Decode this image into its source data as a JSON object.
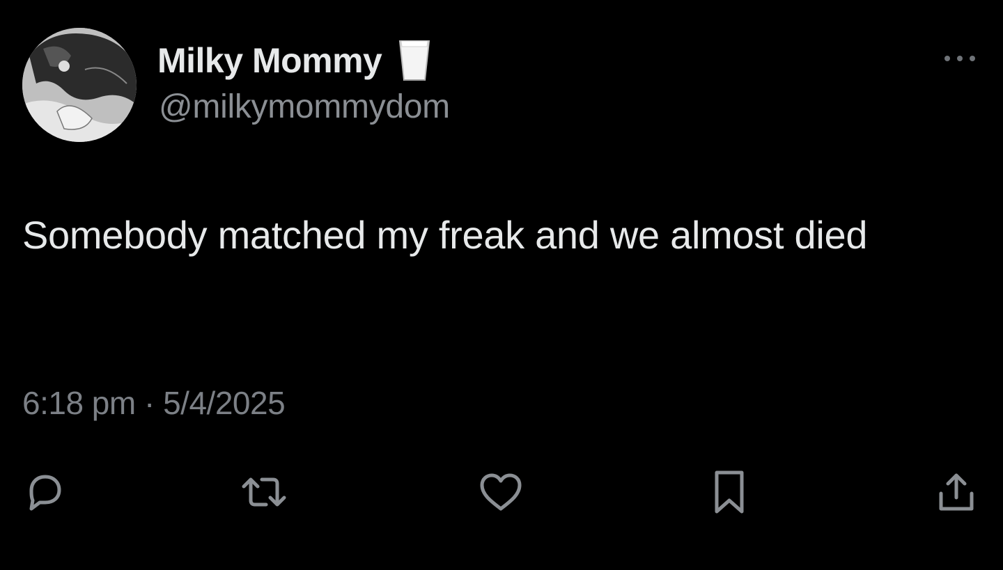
{
  "tweet": {
    "display_name": "Milky Mommy",
    "name_emoji_icon": "glass-of-milk-icon",
    "handle": "@milkymommydom",
    "text": "Somebody matched my freak and we almost died",
    "timestamp": "6:18 pm · 5/4/2025"
  },
  "actions": [
    "reply-icon",
    "retweet-icon",
    "like-icon",
    "bookmark-icon",
    "share-icon"
  ],
  "colors": {
    "background": "#000000",
    "primary_text": "#e7e9ea",
    "secondary_text": "#8b8f94",
    "icon": "#8b8f94"
  }
}
